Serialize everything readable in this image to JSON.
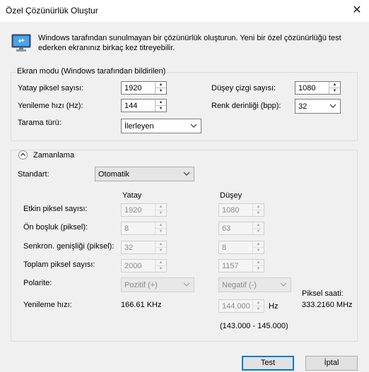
{
  "window": {
    "title": "Özel Çözünürlük Oluştur",
    "close_glyph": "✕"
  },
  "intro_line1": "Windows tarafından sunulmayan bir çözünürlük oluşturun. Yeni bir özel çözünürlüğü test",
  "intro_line2": "ederken ekranınız birkaç kez titreyebilir.",
  "display_mode": {
    "legend": "Ekran modu (Windows tarafından bildirilen)",
    "h_pixels_label": "Yatay piksel sayısı:",
    "h_pixels": "1920",
    "v_lines_label": "Düşey çizgi sayısı:",
    "v_lines": "1080",
    "refresh_label": "Yenileme hızı (Hz):",
    "refresh": "144",
    "color_depth_label": "Renk derinliği (bpp):",
    "color_depth": "32",
    "scan_type_label": "Tarama türü:",
    "scan_type": "İlerleyen"
  },
  "timing": {
    "legend": "Zamanlama",
    "standard_label": "Standart:",
    "standard": "Otomatik",
    "col_horizontal": "Yatay",
    "col_vertical": "Düşey",
    "rows": [
      {
        "label": "Etkin piksel sayısı:",
        "h": "1920",
        "v": "1080"
      },
      {
        "label": "Ön boşluk (piksel):",
        "h": "8",
        "v": "63"
      },
      {
        "label": "Senkron. genişliği (piksel):",
        "h": "32",
        "v": "8"
      },
      {
        "label": "Toplam piksel sayısı:",
        "h": "2000",
        "v": "1157"
      }
    ],
    "polarity_label": "Polarite:",
    "polarity_h": "Pozitif (+)",
    "polarity_v": "Negatif (-)",
    "refresh_label": "Yenileme hızı:",
    "h_refresh": "166.61 KHz",
    "v_refresh": "144.000",
    "v_refresh_unit": "Hz",
    "range": "(143.000 - 145.000)",
    "pixel_clock_label": "Piksel saati:",
    "pixel_clock": "333.2160 MHz"
  },
  "buttons": {
    "test": "Test",
    "cancel": "İptal"
  },
  "colors": {
    "accent": "#0078d7",
    "background": "#f0f0f0"
  }
}
